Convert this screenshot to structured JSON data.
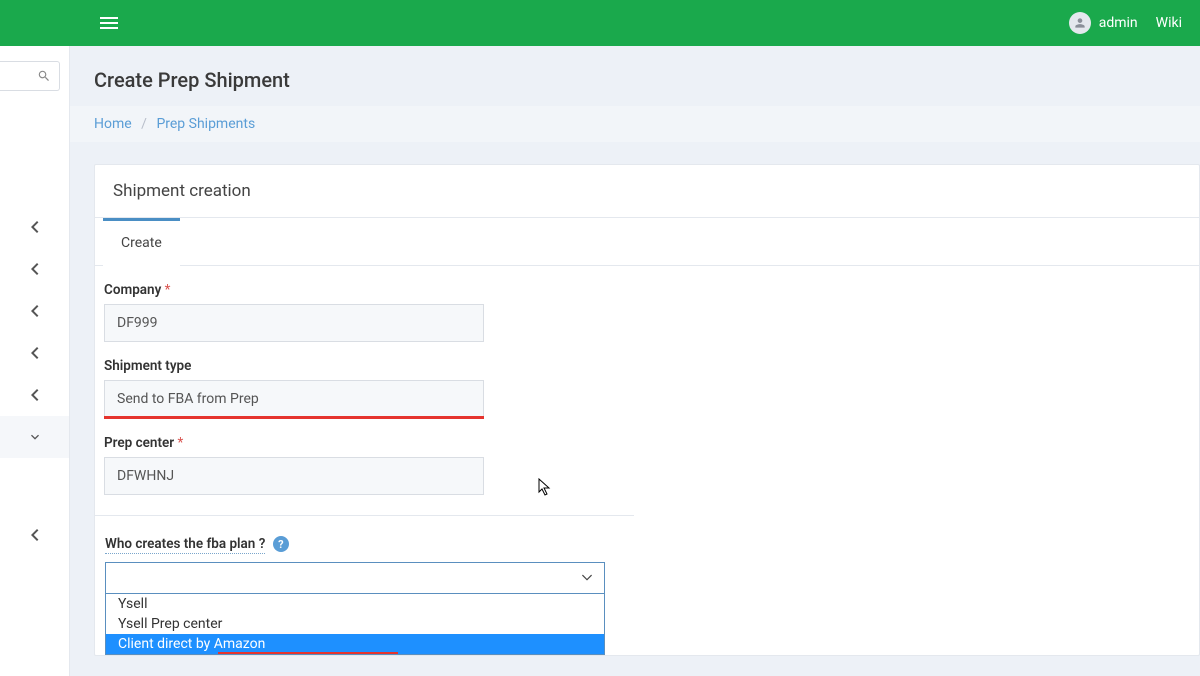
{
  "header": {
    "user": "admin",
    "wiki": "Wiki"
  },
  "page": {
    "title": "Create Prep Shipment",
    "card_title": "Shipment creation"
  },
  "breadcrumb": {
    "home": "Home",
    "current": "Prep Shipments"
  },
  "tabs": {
    "create": "Create"
  },
  "form": {
    "company_label": "Company ",
    "company_value": "DF999",
    "shipment_type_label": "Shipment type",
    "shipment_type_value": "Send to FBA from Prep",
    "prep_center_label": "Prep center ",
    "prep_center_value": "DFWHNJ",
    "who_label": "Who creates the fba plan ? ",
    "help": "?"
  },
  "dropdown": {
    "opt1": "Ysell",
    "opt2": "Ysell Prep center",
    "opt3": "Client direct by Amazon"
  }
}
